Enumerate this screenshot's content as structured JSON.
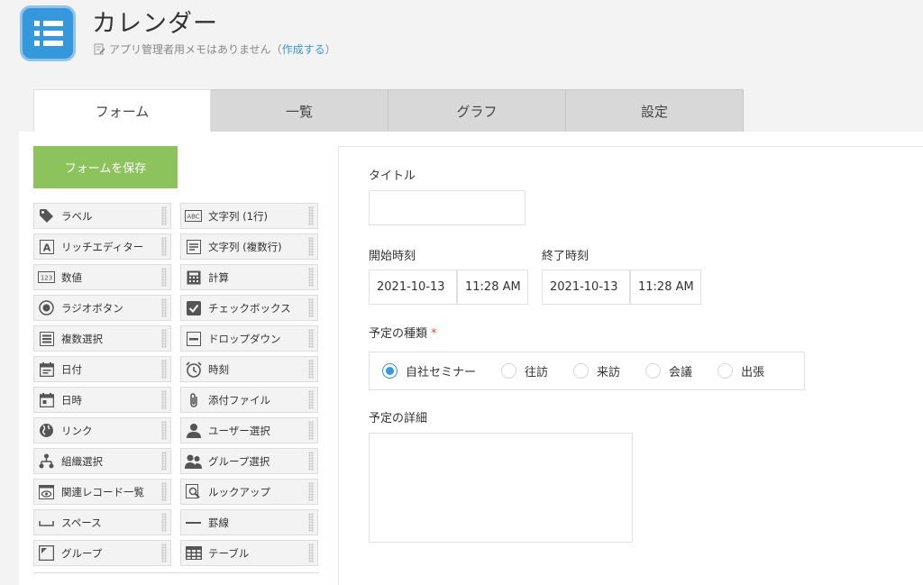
{
  "header": {
    "app_title": "カレンダー",
    "memo_text": "アプリ管理者用メモはありません（",
    "memo_link": "作成する",
    "memo_close": "）"
  },
  "tabs": [
    {
      "label": "フォーム",
      "active": true
    },
    {
      "label": "一覧",
      "active": false
    },
    {
      "label": "グラフ",
      "active": false
    },
    {
      "label": "設定",
      "active": false
    }
  ],
  "palette": {
    "save_label": "フォームを保存",
    "items": [
      {
        "label": "ラベル",
        "icon": "tag-icon"
      },
      {
        "label": "文字列 (1行)",
        "icon": "abc-icon"
      },
      {
        "label": "リッチエディター",
        "icon": "rich-editor-icon"
      },
      {
        "label": "文字列 (複数行)",
        "icon": "multiline-icon"
      },
      {
        "label": "数値",
        "icon": "number-icon"
      },
      {
        "label": "計算",
        "icon": "calculator-icon"
      },
      {
        "label": "ラジオボタン",
        "icon": "radio-icon"
      },
      {
        "label": "チェックボックス",
        "icon": "checkbox-icon"
      },
      {
        "label": "複数選択",
        "icon": "multi-select-icon"
      },
      {
        "label": "ドロップダウン",
        "icon": "dropdown-icon"
      },
      {
        "label": "日付",
        "icon": "date-icon"
      },
      {
        "label": "時刻",
        "icon": "clock-icon"
      },
      {
        "label": "日時",
        "icon": "datetime-icon"
      },
      {
        "label": "添付ファイル",
        "icon": "paperclip-icon"
      },
      {
        "label": "リンク",
        "icon": "globe-icon"
      },
      {
        "label": "ユーザー選択",
        "icon": "user-icon"
      },
      {
        "label": "組織選択",
        "icon": "org-icon"
      },
      {
        "label": "グループ選択",
        "icon": "group-icon"
      },
      {
        "label": "関連レコード一覧",
        "icon": "related-records-icon"
      },
      {
        "label": "ルックアップ",
        "icon": "lookup-icon"
      },
      {
        "label": "スペース",
        "icon": "space-icon"
      },
      {
        "label": "罫線",
        "icon": "line-icon"
      },
      {
        "label": "グループ",
        "icon": "group-folder-icon"
      },
      {
        "label": "テーブル",
        "icon": "table-icon"
      }
    ]
  },
  "form": {
    "title_label": "タイトル",
    "title_value": "",
    "start_label": "開始時刻",
    "start_date": "2021-10-13",
    "start_time": "11:28 AM",
    "end_label": "終了時刻",
    "end_date": "2021-10-13",
    "end_time": "11:28 AM",
    "type_label": "予定の種類",
    "required_mark": "*",
    "type_options": [
      {
        "label": "自社セミナー",
        "checked": true
      },
      {
        "label": "往訪",
        "checked": false
      },
      {
        "label": "来訪",
        "checked": false
      },
      {
        "label": "会議",
        "checked": false
      },
      {
        "label": "出張",
        "checked": false
      }
    ],
    "detail_label": "予定の詳細",
    "detail_value": ""
  },
  "colors": {
    "accent": "#3498db",
    "save_button": "#8cc35d",
    "required": "#e74c3c"
  }
}
